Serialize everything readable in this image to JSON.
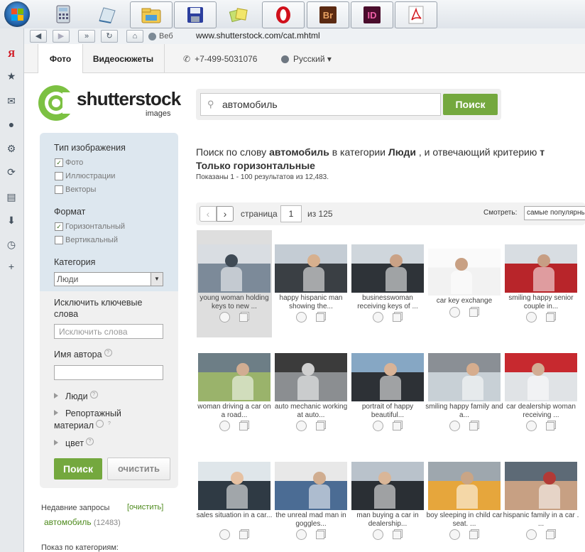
{
  "browser": {
    "url": "www.shutterstock.com/cat.mhtml",
    "web_label": "Веб"
  },
  "tabs": {
    "photo": "Фото",
    "video": "Видеосюжеты",
    "phone": "+7-499-5031076",
    "language": "Русский ▾"
  },
  "logo": {
    "name": "shutterstock",
    "sub": "images"
  },
  "search": {
    "value": "автомобиль",
    "button": "Поиск"
  },
  "results": {
    "heading_prefix": "Поиск по слову",
    "heading_keyword": "автомобиль",
    "heading_mid": "в категории",
    "heading_category": "Люди",
    "heading_suffix": ", и отвечающий критерию",
    "heading_cut": "т",
    "heading_line2": "Только горизонтальные",
    "shown": "Показаны 1 - 100 результатов из 12,483."
  },
  "pager": {
    "page_label": "страница",
    "page": "1",
    "of": "из 125",
    "view_label": "Смотреть:",
    "view_value": "самые популярные"
  },
  "filters": {
    "type_title": "Тип изображения",
    "type_photo": "Фото",
    "type_illus": "Иллюстрации",
    "type_vector": "Векторы",
    "format_title": "Формат",
    "format_h": "Горизонтальный",
    "format_v": "Вертикальный",
    "category_title": "Категория",
    "category_value": "Люди",
    "exclude_title": "Исключить ключевые слова",
    "exclude_placeholder": "Исключить слова",
    "author_title": "Имя автора",
    "people": "Люди",
    "reportage": "Репортажный материал",
    "color": "цвет",
    "search_btn": "Поиск",
    "clear_btn": "очистить"
  },
  "recent": {
    "title": "Недавние запросы",
    "clear": "[очистить]",
    "item": "автомобиль",
    "count": "(12483)"
  },
  "by_category": "Показ по категориям:",
  "tiles": [
    {
      "caption": "young woman holding keys to new ...",
      "colors": [
        "#d9dde2",
        "#7c8a99",
        "#3f4a55"
      ]
    },
    {
      "caption": "happy hispanic man showing the...",
      "colors": [
        "#c4ccd4",
        "#3a3f44",
        "#d7b08e"
      ]
    },
    {
      "caption": "businesswoman receiving keys of ...",
      "colors": [
        "#cfd6dc",
        "#2e3338",
        "#caa286"
      ]
    },
    {
      "caption": "car key exchange",
      "colors": [
        "#fafafa",
        "#f2f2f2",
        "#c8a083"
      ]
    },
    {
      "caption": "smiling happy senior couple in...",
      "colors": [
        "#d8dde2",
        "#b8252a",
        "#c79e84"
      ]
    },
    {
      "caption": "woman driving a car on a road...",
      "colors": [
        "#6d7e86",
        "#9ab36b",
        "#d1ad92"
      ]
    },
    {
      "caption": "auto mechanic working at auto...",
      "colors": [
        "#3b3b3b",
        "#8b8e91",
        "#cfcfcf"
      ]
    },
    {
      "caption": "portrait of happy beautiful...",
      "colors": [
        "#86a7c4",
        "#2d3136",
        "#d8b397"
      ]
    },
    {
      "caption": "smiling happy family and a...",
      "colors": [
        "#8a8f95",
        "#c8d0d6",
        "#d6ad8e"
      ]
    },
    {
      "caption": "car dealership woman receiving ...",
      "colors": [
        "#c7292f",
        "#e0e3e6",
        "#d2ad94"
      ]
    },
    {
      "caption": "sales situation in a car...",
      "colors": [
        "#dfe6ea",
        "#2f3a44",
        "#e6c1a2"
      ]
    },
    {
      "caption": "the unreal mad man in goggles...",
      "colors": [
        "#e8e8e8",
        "#4b6c94",
        "#d0ad90"
      ]
    },
    {
      "caption": "man buying a car in dealership...",
      "colors": [
        "#b9c2cb",
        "#2a2f34",
        "#d9b698"
      ]
    },
    {
      "caption": "boy sleeping in child car seat. ...",
      "colors": [
        "#9ea7ae",
        "#e6a63c",
        "#c9a586"
      ]
    },
    {
      "caption": "hispanic family in a car . ...",
      "colors": [
        "#5d6a76",
        "#c7a083",
        "#b23a36"
      ]
    }
  ]
}
